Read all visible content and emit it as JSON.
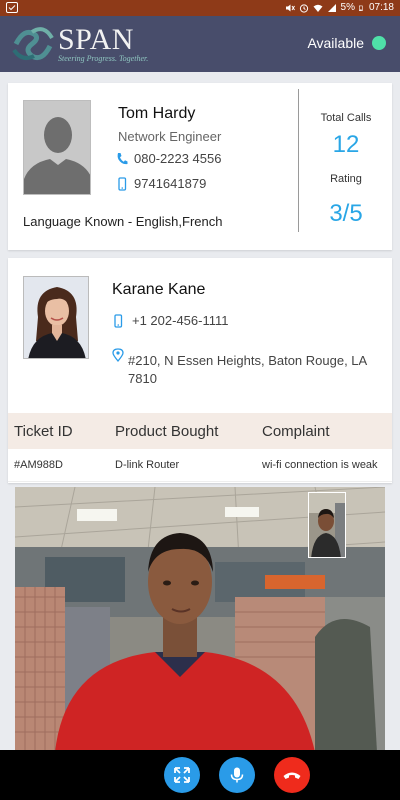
{
  "status_bar": {
    "battery": "5%",
    "time": "07:18"
  },
  "header": {
    "logo_text": "SPAN",
    "tagline": "Steering Progress. Together.",
    "availability_label": "Available",
    "availability_color": "#4fe0a8"
  },
  "agent": {
    "name": "Tom Hardy",
    "role": "Network Engineer",
    "phone": "080-2223 4556",
    "mobile": "9741641879",
    "languages": "Language Known - English,French",
    "total_calls_label": "Total Calls",
    "total_calls": "12",
    "rating_label": "Rating",
    "rating": "3/5"
  },
  "customer": {
    "name": "Karane Kane",
    "phone": "+1 202-456-1111",
    "address": "#210, N Essen Heights, Baton Rouge, LA 7810"
  },
  "ticket_table": {
    "headers": [
      "Ticket ID",
      "Product Bought",
      "Complaint"
    ],
    "rows": [
      [
        "#AM988D",
        "D-link Router",
        "wi-fi connection is weak"
      ]
    ]
  },
  "call_controls": {
    "fullscreen_icon": "fullscreen-icon",
    "mic_icon": "mic-icon",
    "end_call_icon": "end-call-icon"
  },
  "colors": {
    "accent": "#29a6e6",
    "header_bg": "#484d6b",
    "status_bar_bg": "#8e3a18",
    "end_call": "#ef2b1c"
  }
}
